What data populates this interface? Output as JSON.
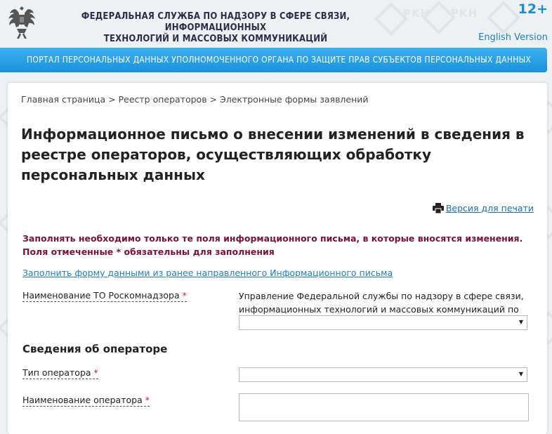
{
  "header": {
    "agency_line1": "ФЕДЕРАЛЬНАЯ СЛУЖБА ПО НАДЗОРУ В СФЕРЕ СВЯЗИ, ИНФОРМАЦИОННЫХ",
    "agency_line2": "ТЕХНОЛОГИЙ И МАССОВЫХ КОММУНИКАЦИЙ",
    "age_rating": "12+",
    "english_link": "English Version"
  },
  "portal": {
    "title": "ПОРТАЛ ПЕРСОНАЛЬНЫХ ДАННЫХ УПОЛНОМОЧЕННОГО ОРГАНА ПО ЗАЩИТЕ ПРАВ СУБЪЕКТОВ ПЕРСОНАЛЬНЫХ ДАННЫХ"
  },
  "breadcrumb": {
    "home": "Главная страница",
    "sep1": " > ",
    "registry": "Реестр операторов",
    "sep2": " > ",
    "current": "Электронные формы заявлений"
  },
  "page": {
    "title": "Информационное письмо о внесении изменений в сведения в реестре операторов, осуществляющих обработку персональных данных",
    "print_link": "Версия для печати",
    "notice": "Заполнять необходимо только те поля информационного письма, в которые вносятся изменения. Поля отмеченные * обязательны для заполнения",
    "fill_link": "Заполнить форму данными из ранее направленного Информационного письма"
  },
  "form": {
    "to_label": "Наименование ТО Роскомнадзора",
    "required_mark": "*",
    "to_value": "Управление Федеральной службы по надзору в сфере связи, информационных технологий и массовых коммуникаций по",
    "section_operator": "Сведения об операторе",
    "operator_type_label": "Тип оператора",
    "operator_name_label": "Наименование оператора",
    "dropdown_arrow": "▼"
  },
  "watermark": {
    "text": "PKH"
  }
}
